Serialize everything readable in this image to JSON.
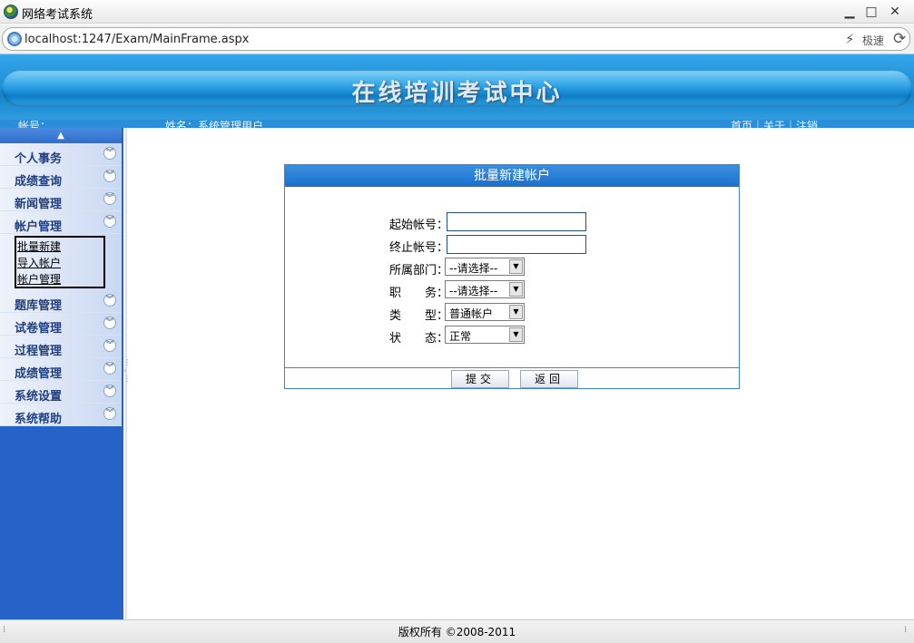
{
  "window": {
    "title": "网络考试系统",
    "minimize": "▁",
    "maximize": "□",
    "close": "✕"
  },
  "addressbar": {
    "url": "localhost:1247/Exam/MainFrame.aspx",
    "speed_label": "极速",
    "speed_icon": "⚡",
    "refresh_icon": "⟳"
  },
  "header": {
    "title": "在线培训考试中心",
    "account_label": "帐号：",
    "name_label": "姓名：系统管理用户",
    "links": "首页｜关于｜注销"
  },
  "sidebar": {
    "collapse_icon": "▲",
    "expand_icon": "︾",
    "items": [
      {
        "label": "个人事务"
      },
      {
        "label": "成绩查询"
      },
      {
        "label": "新闻管理"
      },
      {
        "label": "帐户管理"
      }
    ],
    "submenu": [
      {
        "label": "批量新建"
      },
      {
        "label": "导入帐户"
      },
      {
        "label": "帐户管理"
      }
    ],
    "items_after": [
      {
        "label": "题库管理"
      },
      {
        "label": "试卷管理"
      },
      {
        "label": "过程管理"
      },
      {
        "label": "成绩管理"
      },
      {
        "label": "系统设置"
      },
      {
        "label": "系统帮助"
      }
    ]
  },
  "form": {
    "title": "批量新建帐户",
    "start_account_label": "起始帐号：",
    "end_account_label": "终止帐号：",
    "department_label": "所属部门：",
    "department_value": "--请选择--",
    "position_label": "职　　务：",
    "position_value": "--请选择--",
    "type_label": "类　　型：",
    "type_value": "普通帐户",
    "status_label": "状　　态：",
    "status_value": "正常",
    "submit_label": "提交",
    "back_label": "返回",
    "dropdown_arrow": "▼"
  },
  "footer": {
    "copyright": "版权所有 ©2008-2011"
  }
}
